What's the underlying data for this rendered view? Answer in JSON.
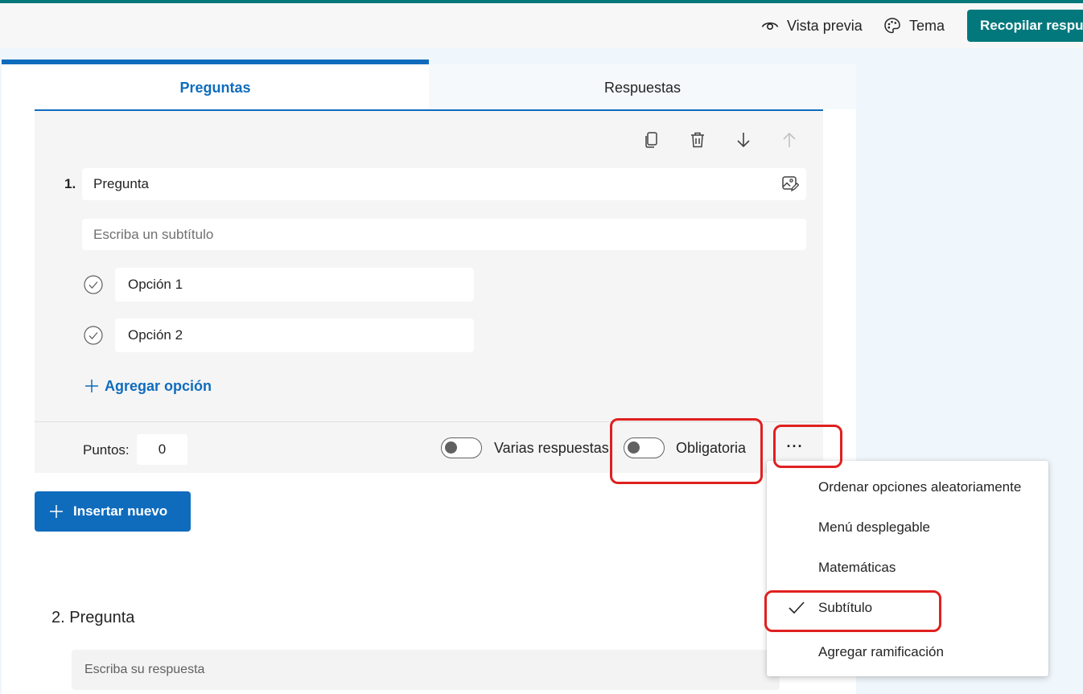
{
  "topbar": {
    "preview_label": "Vista previa",
    "theme_label": "Tema",
    "collect_label": "Recopilar respuestas"
  },
  "tabs": [
    {
      "label": "Preguntas",
      "active": true
    },
    {
      "label": "Respuestas",
      "active": false
    }
  ],
  "question1": {
    "number": "1.",
    "title": "Pregunta",
    "subtitle_placeholder": "Escriba un subtítulo",
    "options": [
      "Opción 1",
      "Opción 2"
    ],
    "add_option_label": "Agregar opción",
    "points_label": "Puntos:",
    "points_value": "0",
    "multiple_answers_label": "Varias respuestas",
    "required_label": "Obligatoria",
    "more_label": "···"
  },
  "insert_new_label": "Insertar nuevo",
  "question2": {
    "title": "2. Pregunta",
    "answer_placeholder": "Escriba su respuesta"
  },
  "more_menu": {
    "items": [
      {
        "label": "Ordenar opciones aleatoriamente",
        "checked": false
      },
      {
        "label": "Menú desplegable",
        "checked": false
      },
      {
        "label": "Matemáticas",
        "checked": false
      },
      {
        "label": "Subtítulo",
        "checked": true
      },
      {
        "label": "Agregar ramificación",
        "checked": false
      }
    ]
  },
  "colors": {
    "accent": "#0f6cbd",
    "brand_teal": "#03787c",
    "annotation_red": "#e02020"
  }
}
